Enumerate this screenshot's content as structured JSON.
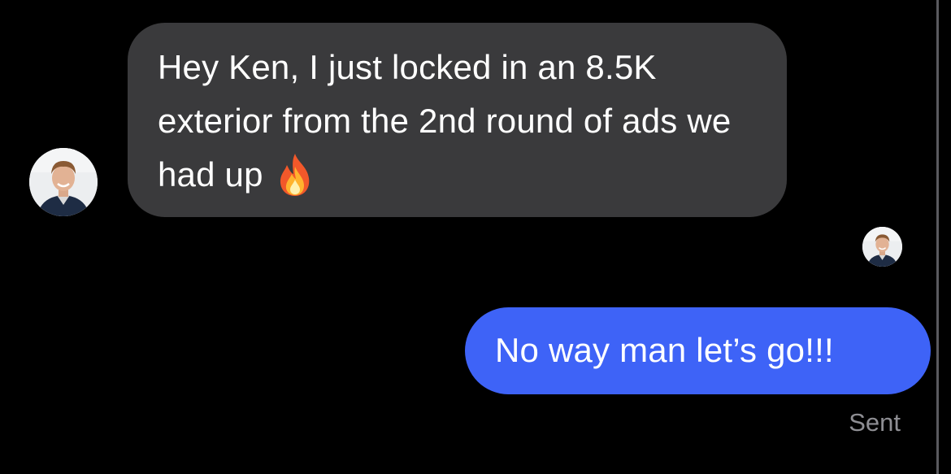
{
  "thread": {
    "incoming_message": {
      "text": "Hey Ken, I just locked in an 8.5K exterior from the 2nd round of ads we had up",
      "emoji": "fire-icon",
      "sender_avatar": "avatar"
    },
    "read_receipt_avatar": "avatar",
    "outgoing_message": {
      "text": "No way man let’s go!!!"
    },
    "status": "Sent"
  },
  "colors": {
    "background": "#000000",
    "incoming_bubble": "#3a3a3c",
    "outgoing_bubble": "#3e63f7",
    "status_text": "#8e8e93"
  }
}
